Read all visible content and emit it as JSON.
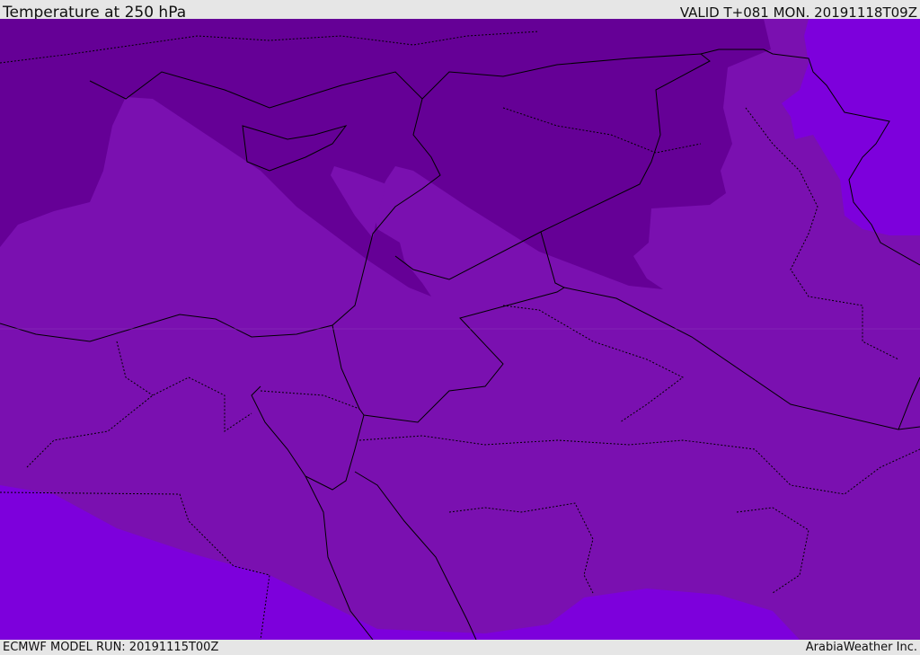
{
  "header": {
    "title": "Temperature at 250 hPa",
    "valid": "VALID T+081 MON. 20191118T09Z"
  },
  "footer": {
    "model_run": "ECMWF MODEL RUN: 20191115T00Z",
    "credit": "ArabiaWeather Inc."
  },
  "colors": {
    "cold": "#650096",
    "mid": "#7a10b0",
    "warm": "#7d00dc",
    "border": "#000000"
  }
}
